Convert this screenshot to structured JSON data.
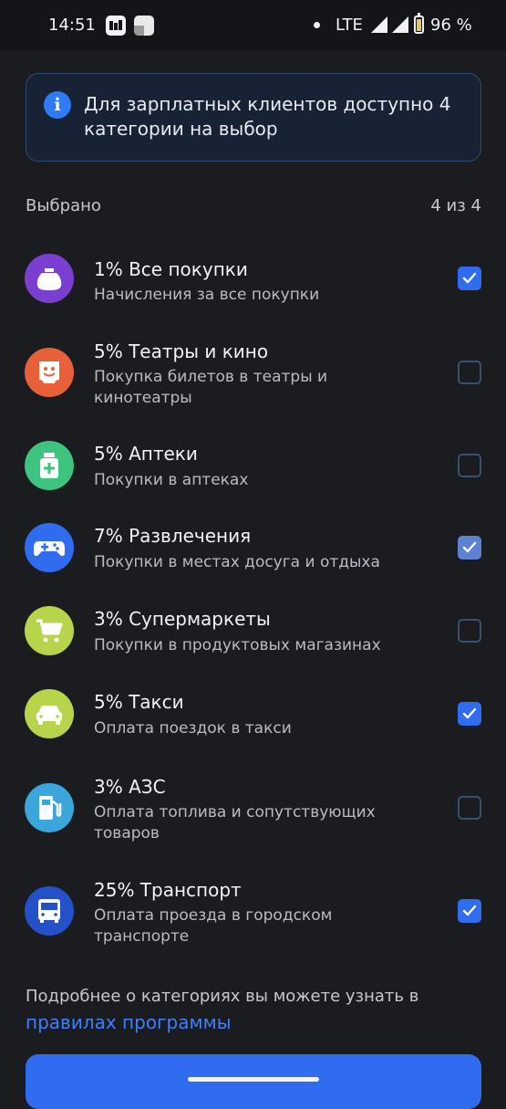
{
  "status_bar": {
    "time": "14:51",
    "network": "LTE",
    "battery": "96 %",
    "battery_level": 0.96
  },
  "info": {
    "icon": "info-icon",
    "glyph": "i",
    "text": "Для зарплатных клиентов доступно 4 категории на выбор"
  },
  "selected": {
    "label": "Выбрано",
    "count": "4 из 4"
  },
  "categories": [
    {
      "title": "1% Все покупки",
      "description": "Начисления за все покупки",
      "checked": true,
      "icon": "shopping-bag-icon",
      "color": "#7a3fd1"
    },
    {
      "title": "5% Театры и кино",
      "description": "Покупка билетов в театры и кинотеатры",
      "checked": false,
      "icon": "ticket-face-icon",
      "color": "#e8603a"
    },
    {
      "title": "5% Аптеки",
      "description": "Покупки в аптеках",
      "checked": false,
      "icon": "pharmacy-icon",
      "color": "#3dc47e"
    },
    {
      "title": "7% Развлечения",
      "description": "Покупки в местах досуга и отдыха",
      "checked": true,
      "icon": "gamepad-icon",
      "color": "#2f6cf0"
    },
    {
      "title": "3% Супермаркеты",
      "description": "Покупки в продуктовых магазинах",
      "checked": false,
      "icon": "shopping-cart-icon",
      "color": "#b7d44a"
    },
    {
      "title": "5% Такси",
      "description": "Оплата поездок в такси",
      "checked": true,
      "icon": "car-icon",
      "color": "#b7d44a"
    },
    {
      "title": "3% АЗС",
      "description": "Оплата топлива и сопутствующих товаров",
      "checked": false,
      "icon": "fuel-pump-icon",
      "color": "#3aa6dc"
    },
    {
      "title": "25% Транспорт",
      "description": "Оплата проезда в городском транспорте",
      "checked": true,
      "icon": "bus-icon",
      "color": "#2450c8"
    }
  ],
  "footer": {
    "text": "Подробнее о категориях вы можете узнать в",
    "link": "правилах программы"
  }
}
